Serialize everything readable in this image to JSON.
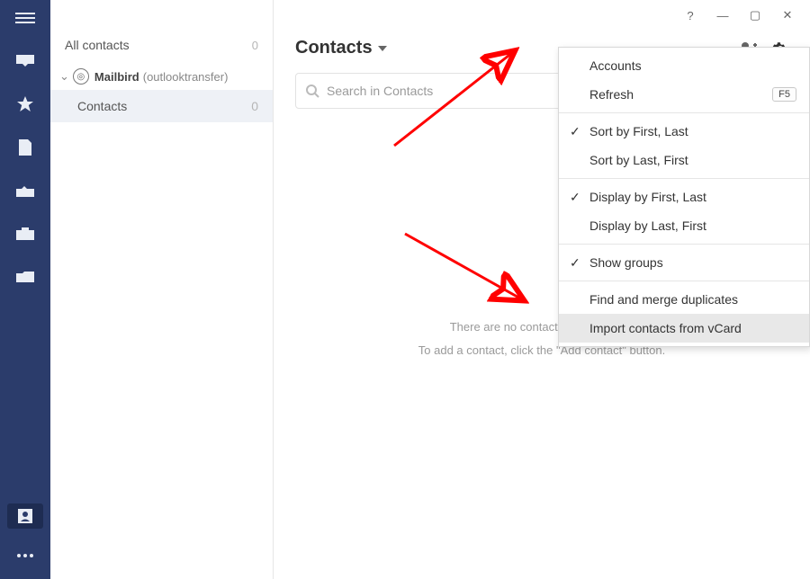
{
  "window": {
    "help": "?",
    "minimize": "—",
    "maximize": "▢",
    "close": "✕"
  },
  "rail": {
    "items": [
      "menu",
      "inbox",
      "star",
      "contacts",
      "outbox",
      "briefcase",
      "folder"
    ],
    "bottom_selected": "addressbook"
  },
  "sidebar": {
    "all_label": "All contacts",
    "all_count": "0",
    "account_name": "Mailbird",
    "account_sub": "(outlooktransfer)",
    "contacts_label": "Contacts",
    "contacts_count": "0"
  },
  "main": {
    "title": "Contacts",
    "search_placeholder": "Search in Contacts",
    "empty_line1": "There are no contacts in this group.",
    "empty_line2": "To add a contact, click the \"Add contact\" button."
  },
  "menu": {
    "accounts": "Accounts",
    "refresh": "Refresh",
    "refresh_key": "F5",
    "sort_first_last": "Sort by First, Last",
    "sort_last_first": "Sort by Last, First",
    "display_first_last": "Display by First, Last",
    "display_last_first": "Display by Last, First",
    "show_groups": "Show groups",
    "find_merge": "Find and merge duplicates",
    "import_vcard": "Import contacts from vCard"
  }
}
